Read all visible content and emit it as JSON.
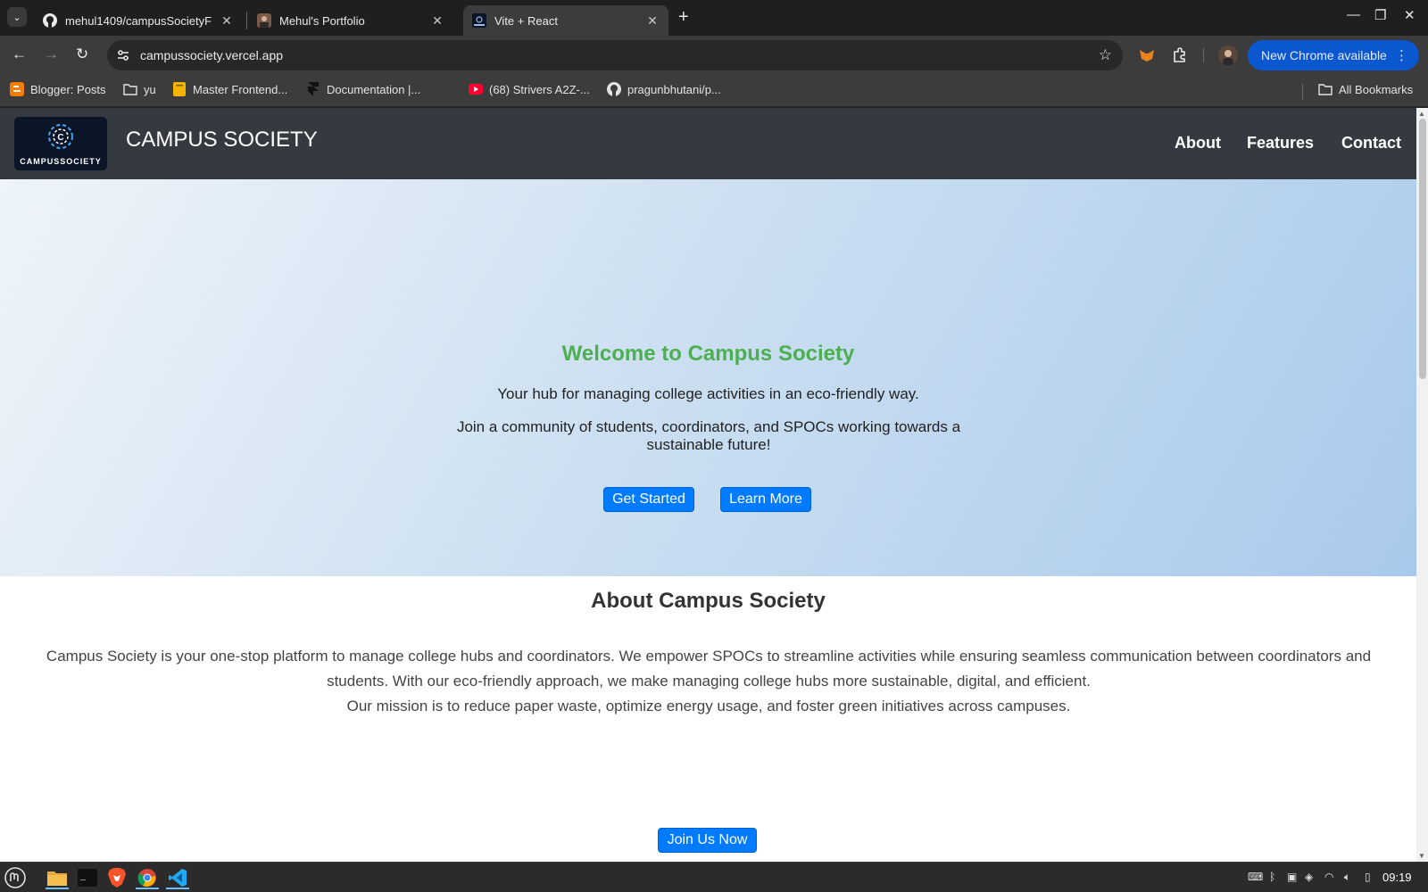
{
  "browser": {
    "tabs": [
      {
        "title": "mehul1409/campusSocietyF",
        "icon": "github-icon"
      },
      {
        "title": "Mehul's Portfolio",
        "icon": "portfolio-avatar-icon"
      },
      {
        "title": "Vite + React",
        "icon": "vite-icon",
        "active": true
      }
    ],
    "url": "campussociety.vercel.app",
    "update_button": "New Chrome available",
    "bookmarks": [
      {
        "label": "Blogger: Posts",
        "icon": "blogger-icon"
      },
      {
        "label": "yu",
        "icon": "folder-icon"
      },
      {
        "label": "Master Frontend...",
        "icon": "notebook-icon"
      },
      {
        "label": "Documentation |...",
        "icon": "framer-icon"
      },
      {
        "label": "(68) Strivers A2Z-...",
        "icon": "youtube-icon"
      },
      {
        "label": "pragunbhutani/p...",
        "icon": "github-icon"
      }
    ],
    "all_bookmarks": "All Bookmarks"
  },
  "site": {
    "logo_text": "CAMPUSSOCIETY",
    "brand": "CAMPUS SOCIETY",
    "nav": [
      "About",
      "Features",
      "Contact"
    ]
  },
  "hero": {
    "title": "Welcome to Campus Society",
    "subtitle": "Your hub for managing college activities in an eco-friendly way.",
    "join_text": "Join a community of students, coordinators, and SPOCs working towards a sustainable future!",
    "primary_button": "Get Started",
    "secondary_button": "Learn More"
  },
  "about": {
    "title": "About Campus Society",
    "paragraph1": "Campus Society is your one-stop platform to manage college hubs and coordinators. We empower SPOCs to streamline activities while ensuring seamless communication between coordinators and students. With our eco-friendly approach, we make managing college hubs more sustainable, digital, and efficient.",
    "paragraph2": "Our mission is to reduce paper waste, optimize energy usage, and foster green initiatives across campuses.",
    "cta_button": "Join Us Now"
  },
  "taskbar": {
    "apps": [
      "mint-menu-icon",
      "files-icon",
      "terminal-icon",
      "brave-icon",
      "chrome-icon",
      "vscode-icon"
    ],
    "clock": "09:19"
  },
  "colors": {
    "accent_blue": "#007bff",
    "hero_title_green": "#4caf50",
    "header_dark": "#343a40",
    "chrome_update_blue": "#0b57d0"
  }
}
